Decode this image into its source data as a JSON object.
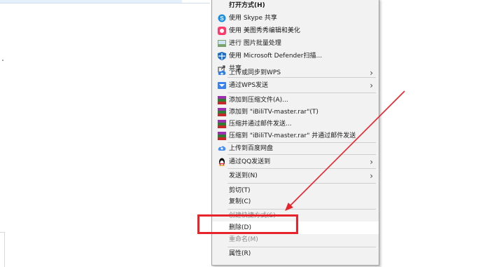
{
  "context_menu": {
    "items": [
      {
        "label": "打开方式(H)",
        "icon": "none",
        "bold": true
      },
      {
        "label": "使用 Skype 共享",
        "icon": "skype-icon"
      },
      {
        "label": "使用 美图秀秀编辑和美化",
        "icon": "meitu-icon"
      },
      {
        "label": "进行 图片批量处理",
        "icon": "batch-image-icon"
      },
      {
        "label": "使用 Microsoft Defender扫描...",
        "icon": "defender-shield-icon"
      },
      {
        "label": "共享",
        "icon": "share-icon"
      },
      {
        "label": "上传或同步到WPS",
        "icon": "wps-cloud-icon",
        "submenu": true
      },
      {
        "label": "通过WPS发送",
        "icon": "wps-send-icon",
        "submenu": true
      },
      {
        "label": "添加到压缩文件(A)...",
        "icon": "winrar-icon"
      },
      {
        "label": "添加到 \"iBiliTV-master.rar\"(T)",
        "icon": "winrar-icon"
      },
      {
        "label": "压缩并通过邮件发送...",
        "icon": "winrar-icon"
      },
      {
        "label": "压缩到 \"iBiliTV-master.rar\" 并通过邮件发送",
        "icon": "winrar-icon"
      },
      {
        "label": "上传到百度网盘",
        "icon": "baidu-cloud-icon"
      },
      {
        "label": "通过QQ发送到",
        "icon": "qq-penguin-icon",
        "submenu": true
      },
      {
        "label": "发送到(N)",
        "icon": "none",
        "submenu": true
      },
      {
        "label": "剪切(T)",
        "icon": "none"
      },
      {
        "label": "复制(C)",
        "icon": "none"
      },
      {
        "label": "创建快捷方式(S)",
        "icon": "none"
      },
      {
        "label": "删除(D)",
        "icon": "none"
      },
      {
        "label": "重命名(M)",
        "icon": "none"
      },
      {
        "label": "属性(R)",
        "icon": "none"
      }
    ],
    "submenu_chevron": "›"
  },
  "annotations": {
    "box_color": "#e8232b",
    "arrow_color": "#e8232b"
  }
}
